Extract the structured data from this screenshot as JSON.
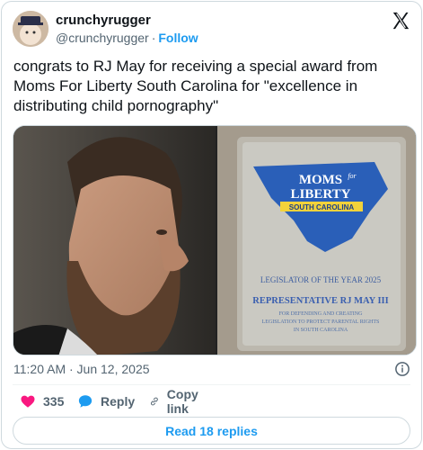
{
  "user": {
    "display_name": "crunchyrugger",
    "handle": "@crunchyrugger",
    "separator": "·",
    "follow_label": "Follow"
  },
  "tweet": {
    "text": "congrats to RJ May for receiving a special award from Moms For Liberty South Carolina for \"excellence in distributing child pornography\"",
    "timestamp": "11:20 AM · Jun 12, 2025"
  },
  "award": {
    "logo_line1": "MOMS",
    "logo_for": "for",
    "logo_line2": "LIBERTY",
    "logo_banner": "SOUTH CAROLINA",
    "title": "LEGISLATOR OF THE YEAR 2025",
    "name": "REPRESENTATIVE RJ MAY III",
    "desc1": "FOR DEFENDING AND CREATING",
    "desc2": "LEGISLATION TO PROTECT PARENTAL RIGHTS",
    "desc3": "IN SOUTH CAROLINA"
  },
  "actions": {
    "like_count": "335",
    "reply_label": "Reply",
    "copy_label": "Copy link"
  },
  "replies_button": "Read 18 replies",
  "colors": {
    "accent": "#1d9bf0",
    "like": "#f91880",
    "muted": "#536471"
  },
  "icons": [
    "x-logo-icon",
    "info-icon",
    "heart-icon",
    "reply-bubble-icon",
    "link-icon"
  ]
}
